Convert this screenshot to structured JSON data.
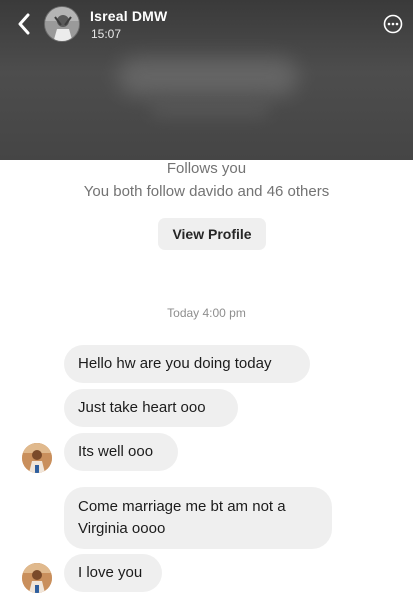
{
  "header": {
    "contact_name": "Isreal DMW",
    "time": "15:07",
    "icons": {
      "back": "chevron-left-icon",
      "more": "more-options-icon"
    }
  },
  "profile": {
    "follows_you": "Follows you",
    "mutual": "You both follow davido and 46 others",
    "view_profile_label": "View Profile"
  },
  "timestamp": "Today 4:00 pm",
  "messages": [
    {
      "text": "Hello hw are you doing today"
    },
    {
      "text": "Just take heart ooo"
    },
    {
      "text": "Its well ooo"
    },
    {
      "text": "Come marriage me bt am not a Virginia oooo"
    },
    {
      "text": "I love you"
    }
  ],
  "colors": {
    "header_bg": "#454545",
    "bubble_bg": "#efefef",
    "muted_text": "#737373",
    "button_bg": "#efefef"
  }
}
